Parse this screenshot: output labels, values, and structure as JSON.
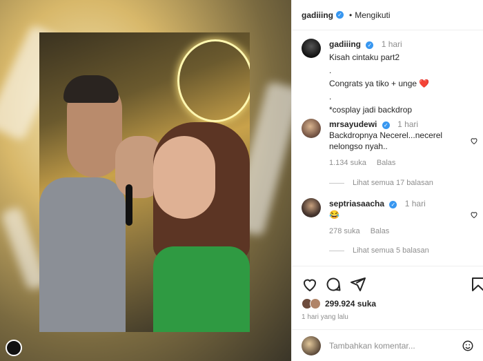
{
  "post": {
    "username": "gadiiing",
    "follow_status": "Mengikuti",
    "caption_time": "1 hari",
    "caption_lines": [
      "Kisah cintaku part2",
      ".",
      "Congrats ya tiko + unge",
      ".",
      "*cosplay jadi backdrop"
    ],
    "caption_heart": "❤️",
    "likes": "299.924 suka",
    "date": "1 hari yang lalu"
  },
  "comments": [
    {
      "username": "mrsayudewi",
      "time": "1 hari",
      "text": "Backdropnya Necerel...necerel nelongso nyah..",
      "likes": "1.134 suka",
      "reply_label": "Balas",
      "view_replies": "Lihat semua 17 balasan"
    },
    {
      "username": "septriasaacha",
      "time": "1 hari",
      "text": "😂",
      "likes": "278 suka",
      "reply_label": "Balas",
      "view_replies": "Lihat semua 5 balasan"
    }
  ],
  "add_comment": {
    "placeholder": "Tambahkan komentar..."
  },
  "colors": {
    "verified": "#3897f0",
    "heart": "#ed4956",
    "muted": "#8e8e8e"
  },
  "icons": [
    "like-icon",
    "comment-icon",
    "share-icon",
    "save-icon",
    "emoji-icon",
    "verified-icon"
  ]
}
